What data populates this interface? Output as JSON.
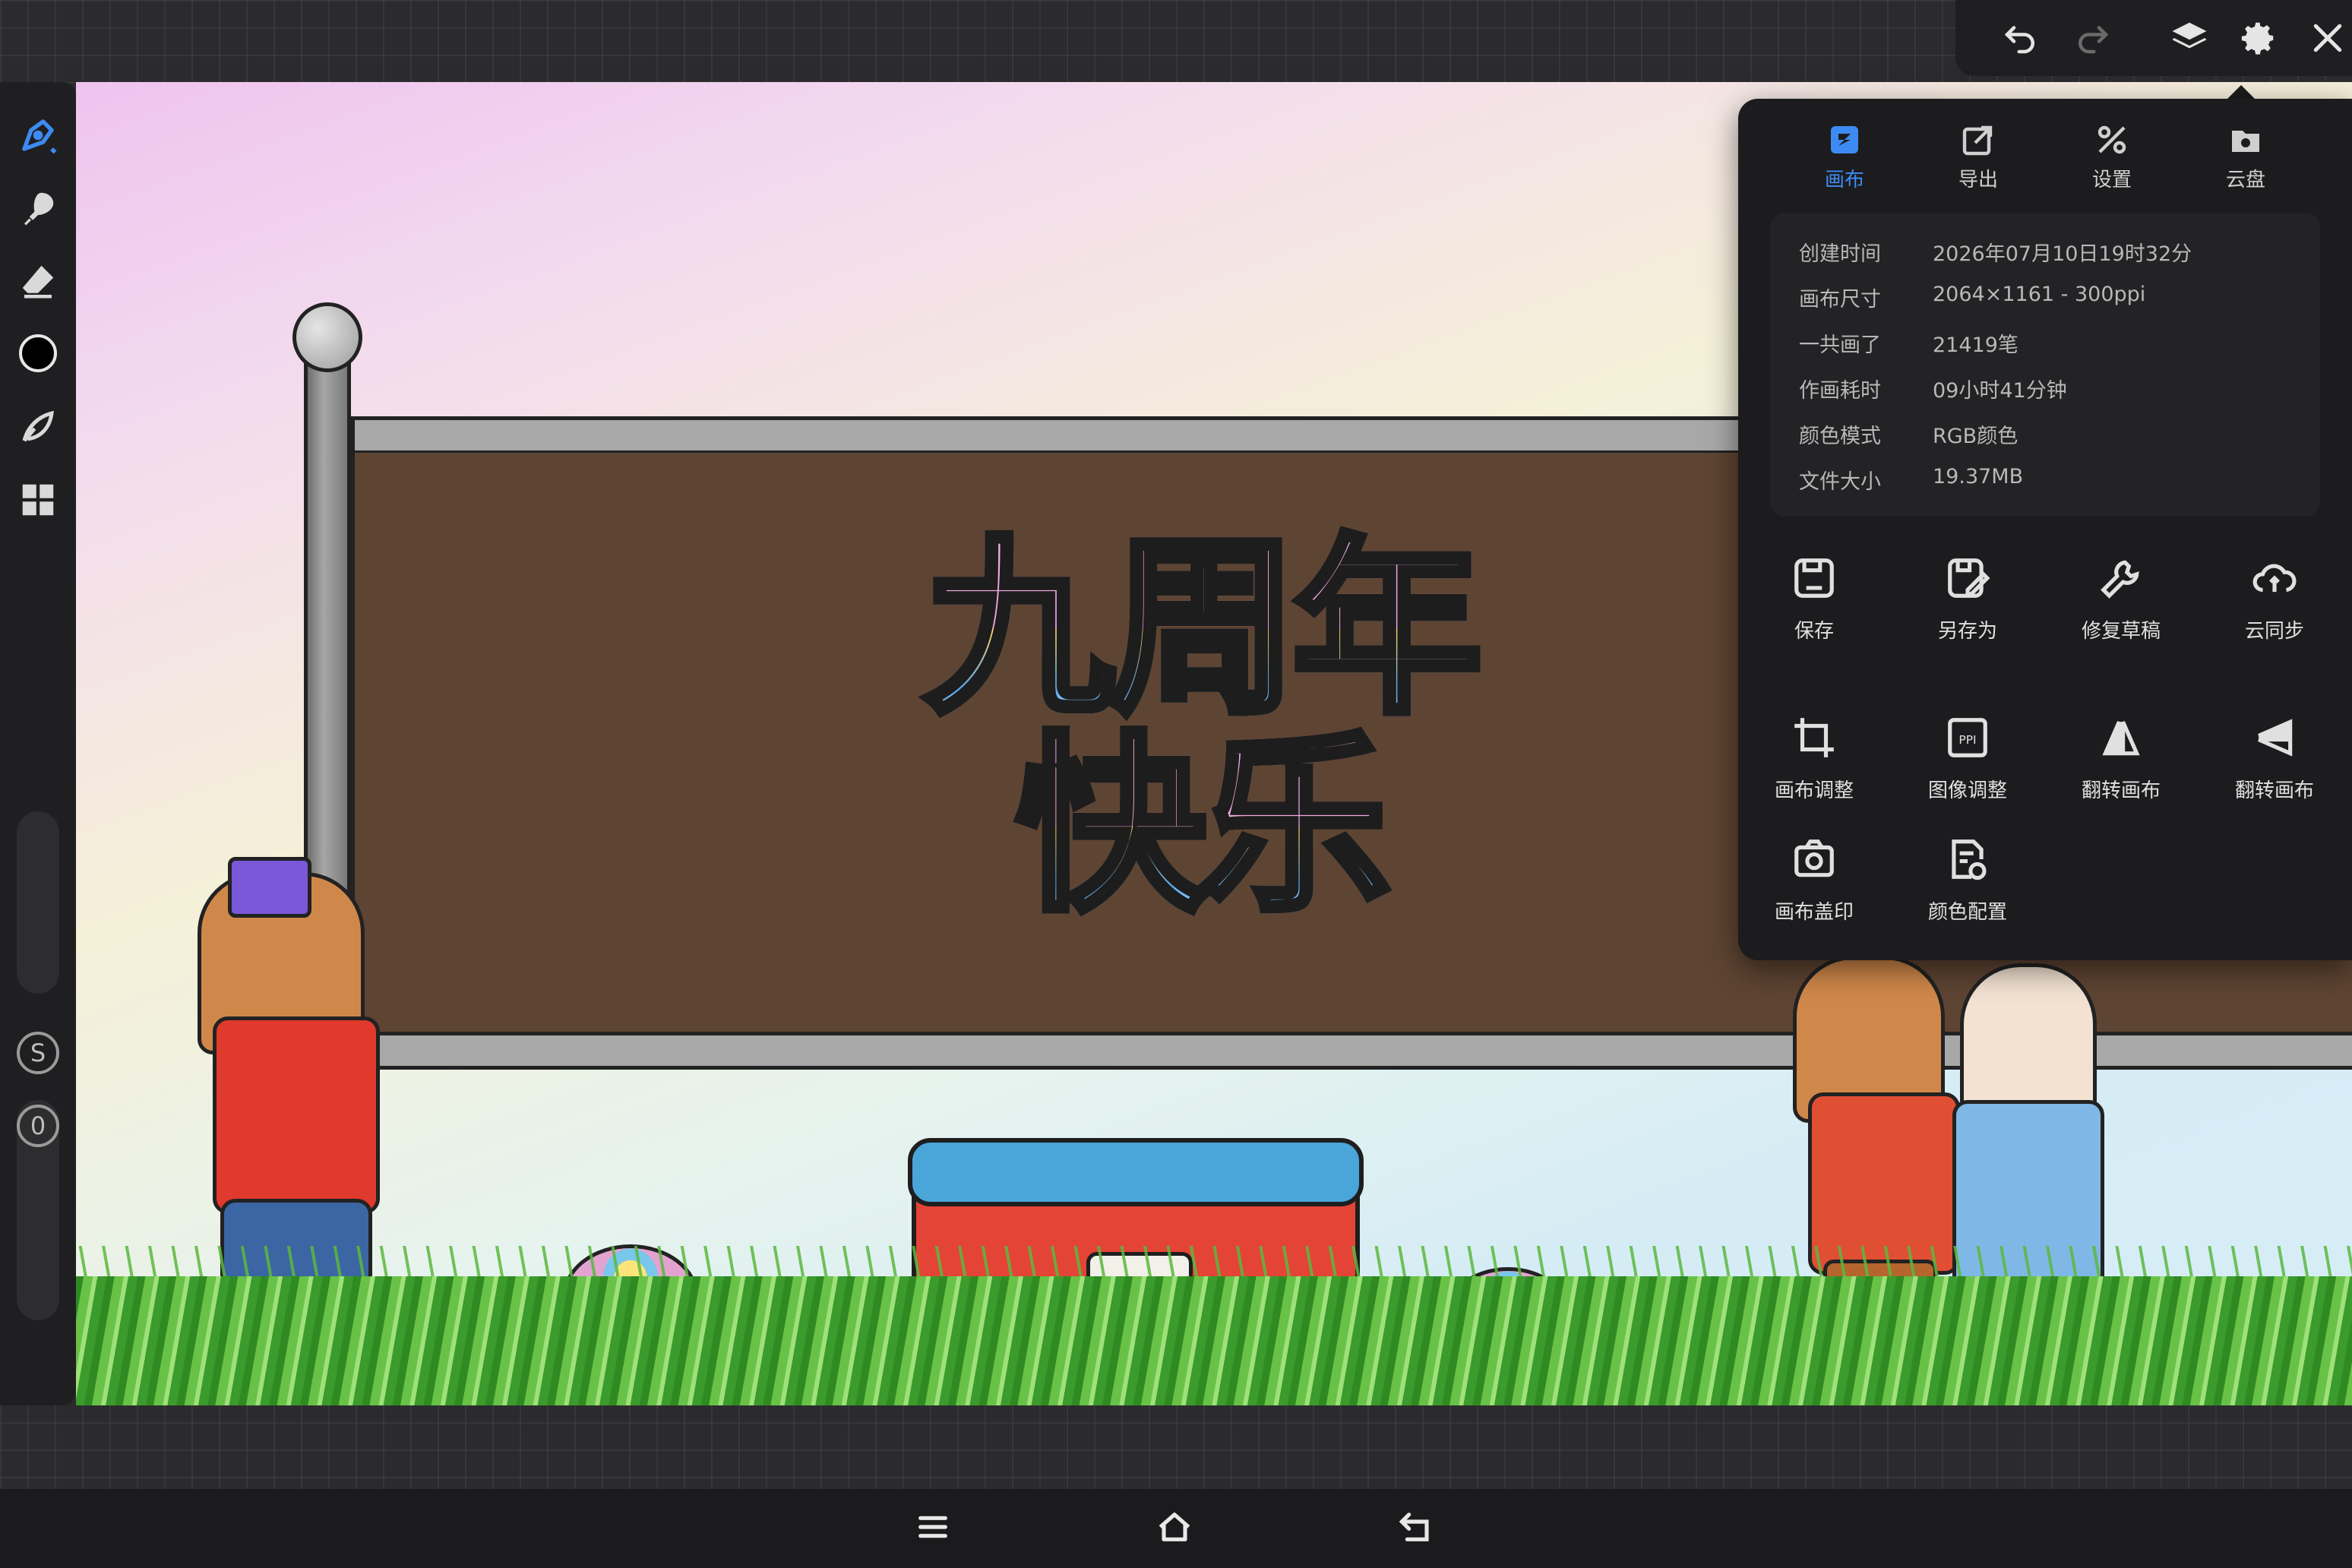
{
  "toolbar": {
    "tools": [
      "brush-tool",
      "smudge-tool",
      "eraser-tool",
      "color-picker",
      "lasso-tool",
      "layout-tool"
    ],
    "current_color": "#000000",
    "size_label": "S",
    "opacity_label": "0"
  },
  "top_bar": {
    "undo": "undo",
    "redo": "redo",
    "layers": "layers",
    "settings": "settings",
    "close": "close"
  },
  "panel": {
    "tabs": [
      {
        "label": "画布",
        "active": true
      },
      {
        "label": "导出",
        "active": false
      },
      {
        "label": "设置",
        "active": false
      },
      {
        "label": "云盘",
        "active": false
      }
    ],
    "info": [
      {
        "key": "创建时间",
        "value": "2026年07月10日19时32分"
      },
      {
        "key": "画布尺寸",
        "value": "2064×1161 - 300ppi"
      },
      {
        "key": "一共画了",
        "value": "21419笔"
      },
      {
        "key": "作画耗时",
        "value": "09小时41分钟"
      },
      {
        "key": "颜色模式",
        "value": "RGB颜色"
      },
      {
        "key": "文件大小",
        "value": "19.37MB"
      }
    ],
    "actions": [
      {
        "label": "保存"
      },
      {
        "label": "另存为"
      },
      {
        "label": "修复草稿"
      },
      {
        "label": "云同步"
      },
      {
        "label": "画布调整"
      },
      {
        "label": "图像调整"
      },
      {
        "label": "翻转画布"
      },
      {
        "label": "翻转画布"
      },
      {
        "label": "画布盖印"
      },
      {
        "label": "颜色配置"
      }
    ]
  },
  "canvas": {
    "headline_line1": "九周年",
    "headline_line2": "快乐"
  },
  "colors": {
    "accent": "#3d8bf2",
    "panel_bg": "#1c1c1e",
    "board": "#5e4432"
  }
}
